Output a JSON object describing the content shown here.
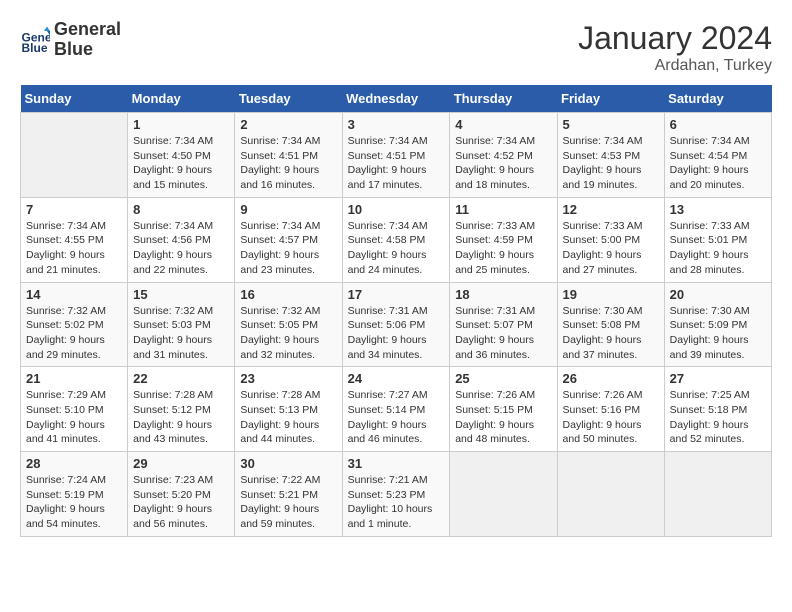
{
  "header": {
    "logo_line1": "General",
    "logo_line2": "Blue",
    "month": "January 2024",
    "location": "Ardahan, Turkey"
  },
  "weekdays": [
    "Sunday",
    "Monday",
    "Tuesday",
    "Wednesday",
    "Thursday",
    "Friday",
    "Saturday"
  ],
  "weeks": [
    [
      {
        "day": "",
        "info": ""
      },
      {
        "day": "1",
        "info": "Sunrise: 7:34 AM\nSunset: 4:50 PM\nDaylight: 9 hours and 15 minutes."
      },
      {
        "day": "2",
        "info": "Sunrise: 7:34 AM\nSunset: 4:51 PM\nDaylight: 9 hours and 16 minutes."
      },
      {
        "day": "3",
        "info": "Sunrise: 7:34 AM\nSunset: 4:51 PM\nDaylight: 9 hours and 17 minutes."
      },
      {
        "day": "4",
        "info": "Sunrise: 7:34 AM\nSunset: 4:52 PM\nDaylight: 9 hours and 18 minutes."
      },
      {
        "day": "5",
        "info": "Sunrise: 7:34 AM\nSunset: 4:53 PM\nDaylight: 9 hours and 19 minutes."
      },
      {
        "day": "6",
        "info": "Sunrise: 7:34 AM\nSunset: 4:54 PM\nDaylight: 9 hours and 20 minutes."
      }
    ],
    [
      {
        "day": "7",
        "info": "Sunrise: 7:34 AM\nSunset: 4:55 PM\nDaylight: 9 hours and 21 minutes."
      },
      {
        "day": "8",
        "info": "Sunrise: 7:34 AM\nSunset: 4:56 PM\nDaylight: 9 hours and 22 minutes."
      },
      {
        "day": "9",
        "info": "Sunrise: 7:34 AM\nSunset: 4:57 PM\nDaylight: 9 hours and 23 minutes."
      },
      {
        "day": "10",
        "info": "Sunrise: 7:34 AM\nSunset: 4:58 PM\nDaylight: 9 hours and 24 minutes."
      },
      {
        "day": "11",
        "info": "Sunrise: 7:33 AM\nSunset: 4:59 PM\nDaylight: 9 hours and 25 minutes."
      },
      {
        "day": "12",
        "info": "Sunrise: 7:33 AM\nSunset: 5:00 PM\nDaylight: 9 hours and 27 minutes."
      },
      {
        "day": "13",
        "info": "Sunrise: 7:33 AM\nSunset: 5:01 PM\nDaylight: 9 hours and 28 minutes."
      }
    ],
    [
      {
        "day": "14",
        "info": "Sunrise: 7:32 AM\nSunset: 5:02 PM\nDaylight: 9 hours and 29 minutes."
      },
      {
        "day": "15",
        "info": "Sunrise: 7:32 AM\nSunset: 5:03 PM\nDaylight: 9 hours and 31 minutes."
      },
      {
        "day": "16",
        "info": "Sunrise: 7:32 AM\nSunset: 5:05 PM\nDaylight: 9 hours and 32 minutes."
      },
      {
        "day": "17",
        "info": "Sunrise: 7:31 AM\nSunset: 5:06 PM\nDaylight: 9 hours and 34 minutes."
      },
      {
        "day": "18",
        "info": "Sunrise: 7:31 AM\nSunset: 5:07 PM\nDaylight: 9 hours and 36 minutes."
      },
      {
        "day": "19",
        "info": "Sunrise: 7:30 AM\nSunset: 5:08 PM\nDaylight: 9 hours and 37 minutes."
      },
      {
        "day": "20",
        "info": "Sunrise: 7:30 AM\nSunset: 5:09 PM\nDaylight: 9 hours and 39 minutes."
      }
    ],
    [
      {
        "day": "21",
        "info": "Sunrise: 7:29 AM\nSunset: 5:10 PM\nDaylight: 9 hours and 41 minutes."
      },
      {
        "day": "22",
        "info": "Sunrise: 7:28 AM\nSunset: 5:12 PM\nDaylight: 9 hours and 43 minutes."
      },
      {
        "day": "23",
        "info": "Sunrise: 7:28 AM\nSunset: 5:13 PM\nDaylight: 9 hours and 44 minutes."
      },
      {
        "day": "24",
        "info": "Sunrise: 7:27 AM\nSunset: 5:14 PM\nDaylight: 9 hours and 46 minutes."
      },
      {
        "day": "25",
        "info": "Sunrise: 7:26 AM\nSunset: 5:15 PM\nDaylight: 9 hours and 48 minutes."
      },
      {
        "day": "26",
        "info": "Sunrise: 7:26 AM\nSunset: 5:16 PM\nDaylight: 9 hours and 50 minutes."
      },
      {
        "day": "27",
        "info": "Sunrise: 7:25 AM\nSunset: 5:18 PM\nDaylight: 9 hours and 52 minutes."
      }
    ],
    [
      {
        "day": "28",
        "info": "Sunrise: 7:24 AM\nSunset: 5:19 PM\nDaylight: 9 hours and 54 minutes."
      },
      {
        "day": "29",
        "info": "Sunrise: 7:23 AM\nSunset: 5:20 PM\nDaylight: 9 hours and 56 minutes."
      },
      {
        "day": "30",
        "info": "Sunrise: 7:22 AM\nSunset: 5:21 PM\nDaylight: 9 hours and 59 minutes."
      },
      {
        "day": "31",
        "info": "Sunrise: 7:21 AM\nSunset: 5:23 PM\nDaylight: 10 hours and 1 minute."
      },
      {
        "day": "",
        "info": ""
      },
      {
        "day": "",
        "info": ""
      },
      {
        "day": "",
        "info": ""
      }
    ]
  ]
}
